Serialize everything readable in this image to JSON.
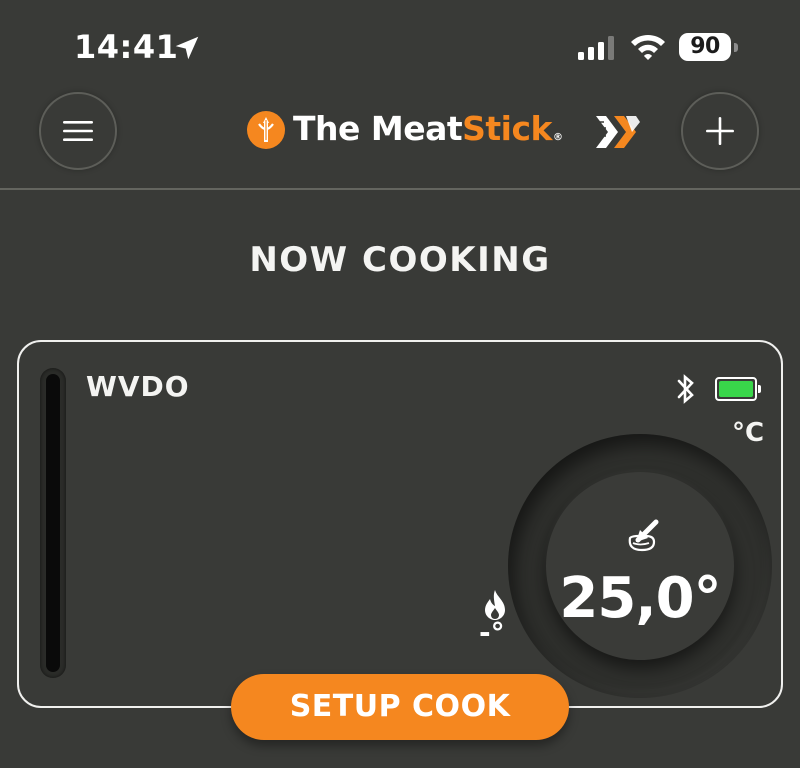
{
  "status_bar": {
    "time": "14:41",
    "battery_level": "90",
    "location_icon": "location-arrow-icon",
    "signal_icon": "cellular-signal-icon",
    "wifi_icon": "wifi-icon"
  },
  "header": {
    "menu_icon": "hamburger-menu-icon",
    "brand_the": "The ",
    "brand_meat": "Meat",
    "brand_stick": "Stick",
    "brand_reg": "®",
    "brand_logo_icon": "meatstick-logo-icon",
    "partner_icon": "x-logo-icon",
    "add_icon": "plus-icon"
  },
  "page": {
    "title": "NOW COOKING"
  },
  "cook_card": {
    "probe_name": "WVDO",
    "bluetooth_icon": "bluetooth-icon",
    "probe_battery_level": 1.0,
    "unit": "°C",
    "meat_icon": "meat-probe-icon",
    "internal_temp": "25,0°",
    "ambient_icon": "flame-icon",
    "ambient_temp": "-°",
    "setup_button_label": "SETUP COOK"
  },
  "colors": {
    "background": "#393a37",
    "accent": "#f5871f",
    "battery_green": "#39d64a",
    "text": "#f4f4f2"
  }
}
